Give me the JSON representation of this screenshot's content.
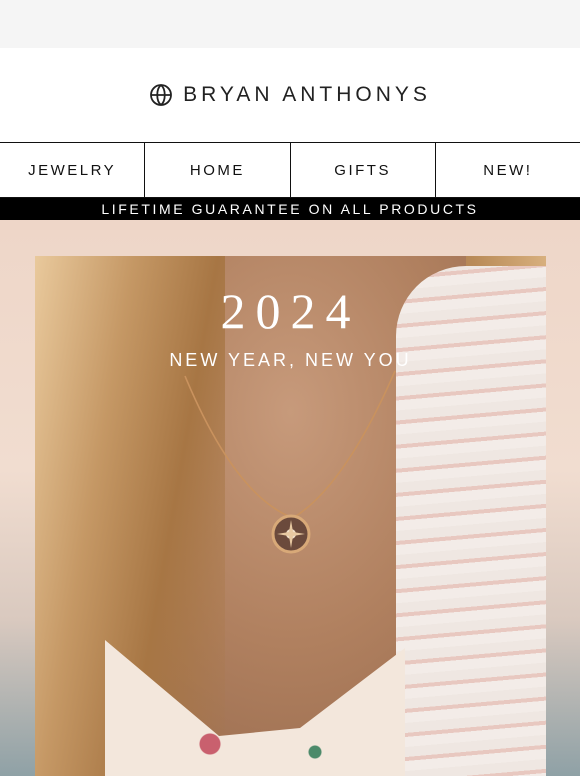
{
  "brand": {
    "name": "BRYAN ANTHONYS",
    "logo_icon": "compass-globe-icon"
  },
  "nav": {
    "items": [
      {
        "label": "JEWELRY"
      },
      {
        "label": "HOME"
      },
      {
        "label": "GIFTS"
      },
      {
        "label": "NEW!"
      }
    ]
  },
  "banner": {
    "text": "LIFETIME GUARANTEE ON ALL PRODUCTS"
  },
  "hero": {
    "title": "2024",
    "subtitle": "NEW YEAR, NEW YOU",
    "image_icon": "necklace-photo"
  },
  "colors": {
    "banner_bg": "#000000",
    "hero_bg": "#eed6c8",
    "text_dark": "#111111",
    "text_light": "#ffffff"
  }
}
